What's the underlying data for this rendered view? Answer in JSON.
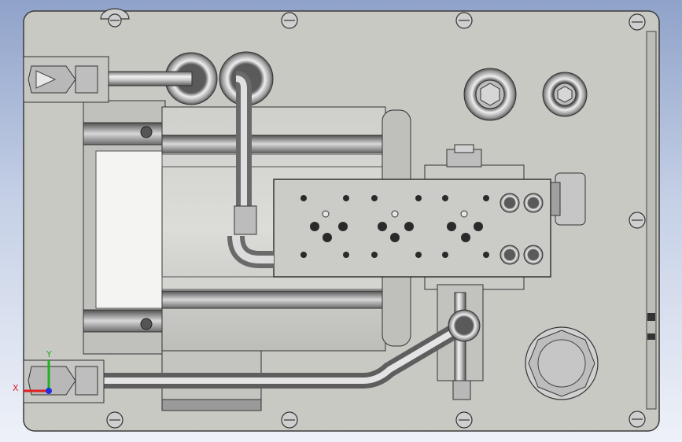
{
  "viewport": {
    "background_top": "#8fa2c9",
    "background_bottom": "#eef1f8",
    "part_color": "#c9c9c4",
    "metal_color": "#a8a8a8"
  },
  "triad": {
    "x_label": "X",
    "y_label": "Y",
    "x_color": "#e02020",
    "y_color": "#20b020",
    "z_color": "#2030e0"
  }
}
